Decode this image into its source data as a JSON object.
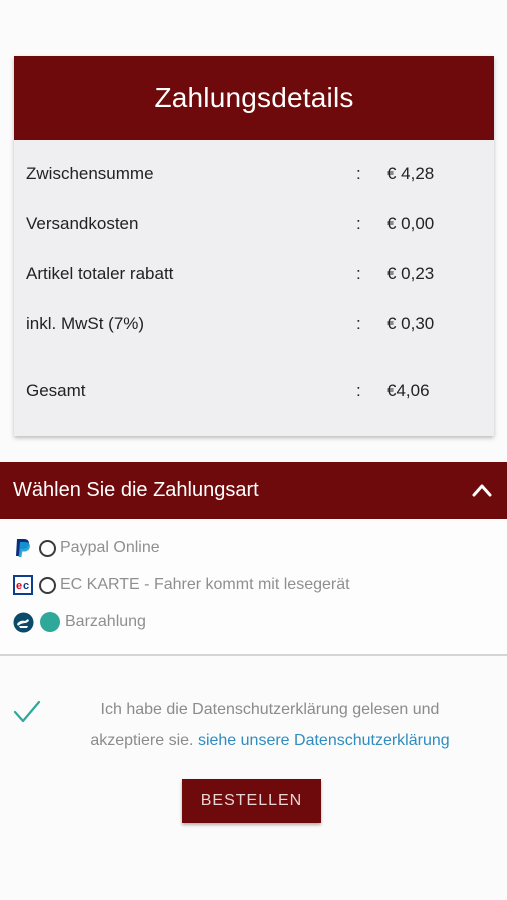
{
  "summary": {
    "title": "Zahlungsdetails",
    "rows": [
      {
        "label": "Zwischensumme",
        "sep": ":",
        "value": "€ 4,28"
      },
      {
        "label": "Versandkosten",
        "sep": ":",
        "value": "€ 0,00"
      },
      {
        "label": "Artikel totaler rabatt",
        "sep": ":",
        "value": "€ 0,23"
      },
      {
        "label": "inkl. MwSt (7%)",
        "sep": ":",
        "value": "€ 0,30"
      }
    ],
    "total": {
      "label": "Gesamt",
      "sep": ":",
      "value": "€4,06"
    }
  },
  "payment": {
    "header": "Wählen Sie die Zahlungsart",
    "toggle_icon": "chevron-up-icon",
    "options": [
      {
        "label": "Paypal Online",
        "icon": "paypal-icon",
        "selected": false
      },
      {
        "label": "EC KARTE - Fahrer kommt mit lesegerät",
        "icon": "ec-card-icon",
        "selected": false
      },
      {
        "label": "Barzahlung",
        "icon": "cash-icon",
        "selected": true
      }
    ],
    "selected_color": "#2fa89a"
  },
  "agreement": {
    "checked": true,
    "text": "Ich habe die Datenschutzerklärung gelesen und akzeptiere sie.",
    "link": "siehe unsere Datenschutzerklärung"
  },
  "order_button": "BESTELLEN",
  "colors": {
    "brand": "#6e0a0b",
    "link": "#2e8cbf",
    "check": "#2fa89a"
  }
}
